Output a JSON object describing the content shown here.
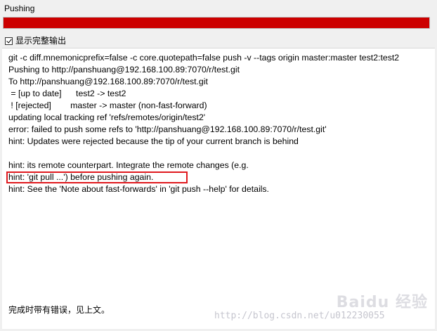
{
  "window": {
    "title": "Pushing"
  },
  "progress": {
    "fraction": 1.0,
    "color": "#cc0000"
  },
  "options": {
    "show_full_output_label": "显示完整输出",
    "show_full_output_checked": true
  },
  "log": {
    "lines": [
      "git -c diff.mnemonicprefix=false -c core.quotepath=false push -v --tags origin master:master test2:test2",
      "Pushing to http://panshuang@192.168.100.89:7070/r/test.git",
      "To http://panshuang@192.168.100.89:7070/r/test.git",
      " = [up to date]      test2 -> test2",
      " ! [rejected]        master -> master (non-fast-forward)",
      "updating local tracking ref 'refs/remotes/origin/test2'",
      "error: failed to push some refs to 'http://panshuang@192.168.100.89:7070/r/test.git'",
      "hint: Updates were rejected because the tip of your current branch is behind",
      "",
      "hint: its remote counterpart. Integrate the remote changes (e.g.",
      "hint: 'git pull ...') before pushing again.",
      "hint: See the 'Note about fast-forwards' in 'git push --help' for details."
    ],
    "highlight_color": "#e0191e"
  },
  "footer": {
    "status": "完成时带有错误，见上文。"
  },
  "watermark": {
    "logo": "Baidu 经验",
    "url": "http://blog.csdn.net/u012230055"
  }
}
